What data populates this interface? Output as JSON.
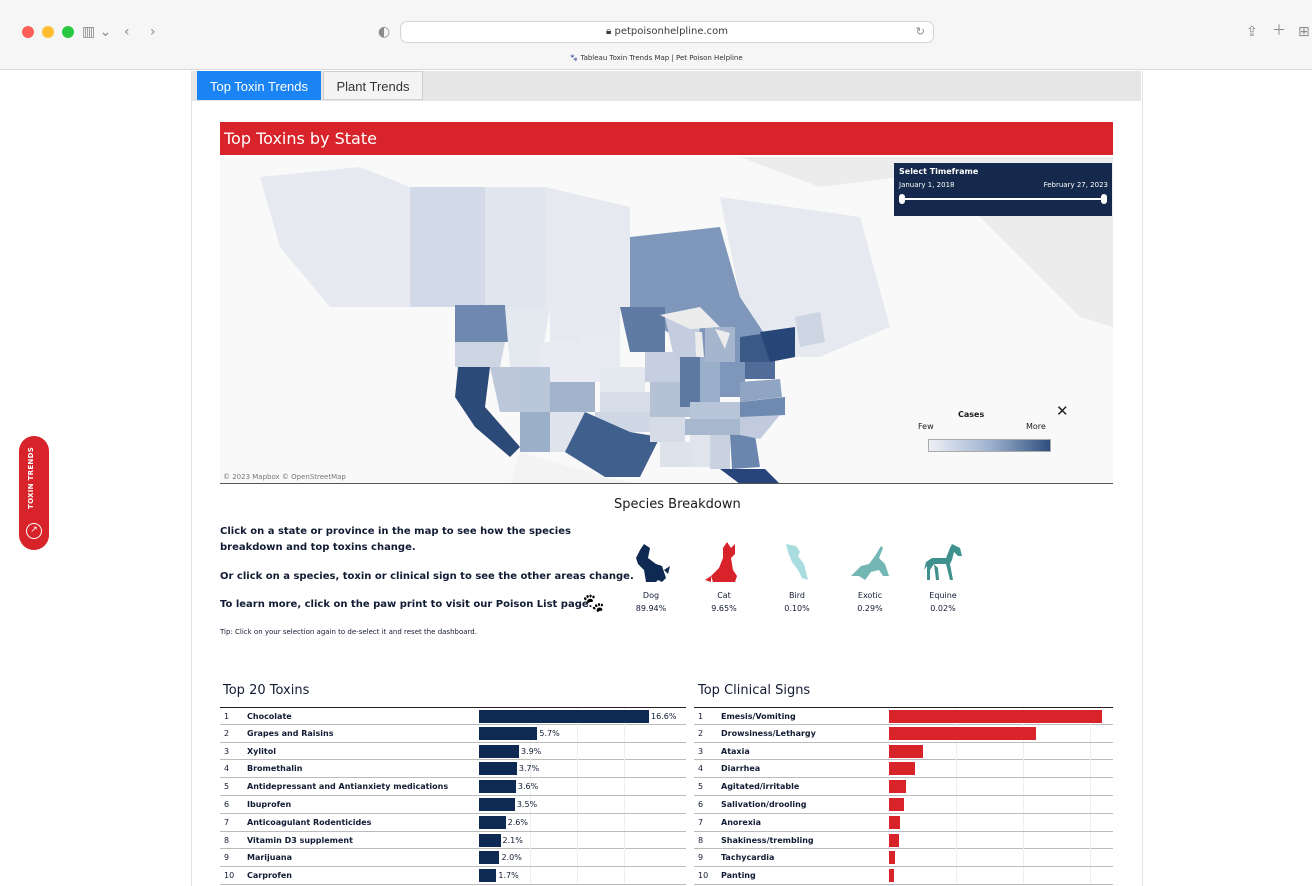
{
  "browser": {
    "url": "petpoisonhelpline.com",
    "tab_title": "Tableau Toxin Trends Map | Pet Poison Helpline"
  },
  "tabs": [
    {
      "label": "Top Toxin Trends",
      "active": true
    },
    {
      "label": "Plant Trends",
      "active": false
    }
  ],
  "side_tab": {
    "label": "TOXIN TRENDS"
  },
  "dashboard": {
    "title": "Top Toxins by State",
    "map_credit": "© 2023 Mapbox  © OpenStreetMap",
    "timeframe": {
      "title": "Select Timeframe",
      "start": "January 1, 2018",
      "end": "February 27, 2023",
      "range_fraction": [
        0.0,
        1.0
      ]
    },
    "legend": {
      "title": "Cases",
      "low": "Few",
      "high": "More"
    },
    "species_title": "Species Breakdown",
    "instructions": [
      "Click on a state or province in the map to see how the species",
      "breakdown and top toxins change.",
      "Or click on a species, toxin or clinical sign to see the other areas change.",
      "To learn more, click on the paw print to visit our Poison List page."
    ],
    "tip": "Tip: Click on your selection again to de-select it and reset the dashboard.",
    "species": [
      {
        "name": "Dog",
        "pct": "89.94%",
        "color": "#0f2a52",
        "icon": "dog-icon"
      },
      {
        "name": "Cat",
        "pct": "9.65%",
        "color": "#d8232a",
        "icon": "cat-icon"
      },
      {
        "name": "Bird",
        "pct": "0.10%",
        "color": "#a8dcdf",
        "icon": "bird-icon"
      },
      {
        "name": "Exotic",
        "pct": "0.29%",
        "color": "#74b6b4",
        "icon": "lizard-icon"
      },
      {
        "name": "Equine",
        "pct": "0.02%",
        "color": "#3f918e",
        "icon": "horse-icon"
      }
    ]
  },
  "chart_data": [
    {
      "type": "bar",
      "title": "Top 20 Toxins",
      "categories": [
        "Chocolate",
        "Grapes and Raisins",
        "Xylitol",
        "Bromethalin",
        "Antidepressant and Antianxiety medications",
        "Ibuprofen",
        "Anticoagulant Rodenticides",
        "Vitamin D3 supplement",
        "Marijuana",
        "Carprofen"
      ],
      "ranks": [
        "1",
        "2",
        "3",
        "4",
        "5",
        "6",
        "7",
        "8",
        "9",
        "10"
      ],
      "values": [
        16.6,
        5.7,
        3.9,
        3.7,
        3.6,
        3.5,
        2.6,
        2.1,
        2.0,
        1.7
      ],
      "labels": [
        "16.6%",
        "5.7%",
        "3.9%",
        "3.7%",
        "3.6%",
        "3.5%",
        "2.6%",
        "2.1%",
        "2.0%",
        "1.7%"
      ],
      "color": "#0f2a52"
    },
    {
      "type": "bar",
      "title": "Top Clinical Signs",
      "categories": [
        "Emesis/Vomiting",
        "Drowsiness/Lethargy",
        "Ataxia",
        "Diarrhea",
        "Agitated/irritable",
        "Salivation/drooling",
        "Anorexia",
        "Shakiness/trembling",
        "Tachycardia",
        "Panting"
      ],
      "ranks": [
        "1",
        "2",
        "3",
        "4",
        "5",
        "6",
        "7",
        "8",
        "9",
        "10"
      ],
      "values": [
        100,
        69,
        16,
        12,
        8,
        7,
        5,
        4.5,
        3,
        2.5
      ],
      "color": "#d8232a"
    }
  ]
}
